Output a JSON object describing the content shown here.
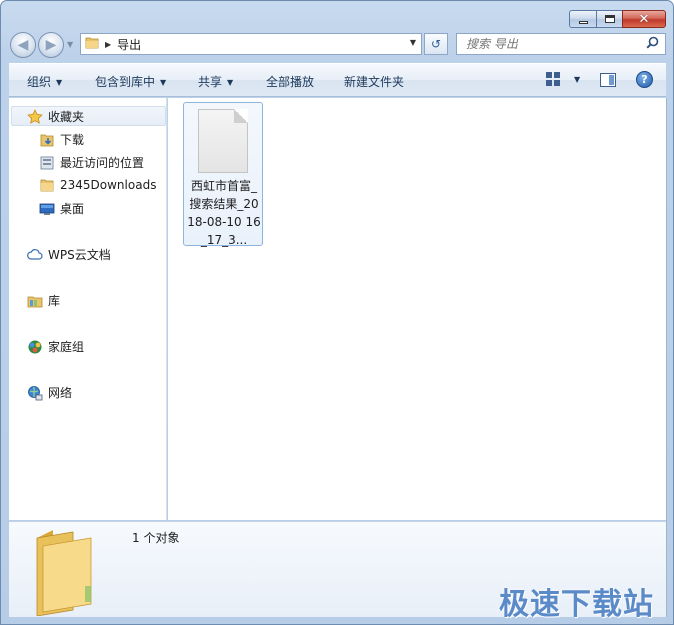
{
  "window": {
    "min_icon": "minimize-icon",
    "max_icon": "maximize-icon",
    "close_glyph": "✕"
  },
  "address": {
    "crumb": "导出",
    "back_glyph": "◀",
    "forward_glyph": "▶",
    "refresh_glyph": "↺"
  },
  "search": {
    "placeholder": "搜索 导出",
    "icon": "search-icon"
  },
  "toolbar": {
    "organize": "组织",
    "include_library": "包含到库中",
    "share": "共享",
    "play_all": "全部播放",
    "new_folder": "新建文件夹",
    "help_glyph": "?"
  },
  "nav": {
    "favorites": "收藏夹",
    "downloads": "下载",
    "recent": "最近访问的位置",
    "downloads2345": "2345Downloads",
    "desktop": "桌面",
    "wps_cloud": "WPS云文档",
    "libraries": "库",
    "homegroup": "家庭组",
    "network": "网络"
  },
  "files": [
    {
      "name": "西虹市首富_搜索结果_2018-08-10 16_17_3...",
      "icon": "text-document-icon"
    }
  ],
  "details": {
    "count": "1 个对象"
  },
  "watermark": "极速下载站",
  "colors": {
    "accent": "#5b8ac8",
    "chrome": "#bcd1ea",
    "close": "#c0392b"
  }
}
